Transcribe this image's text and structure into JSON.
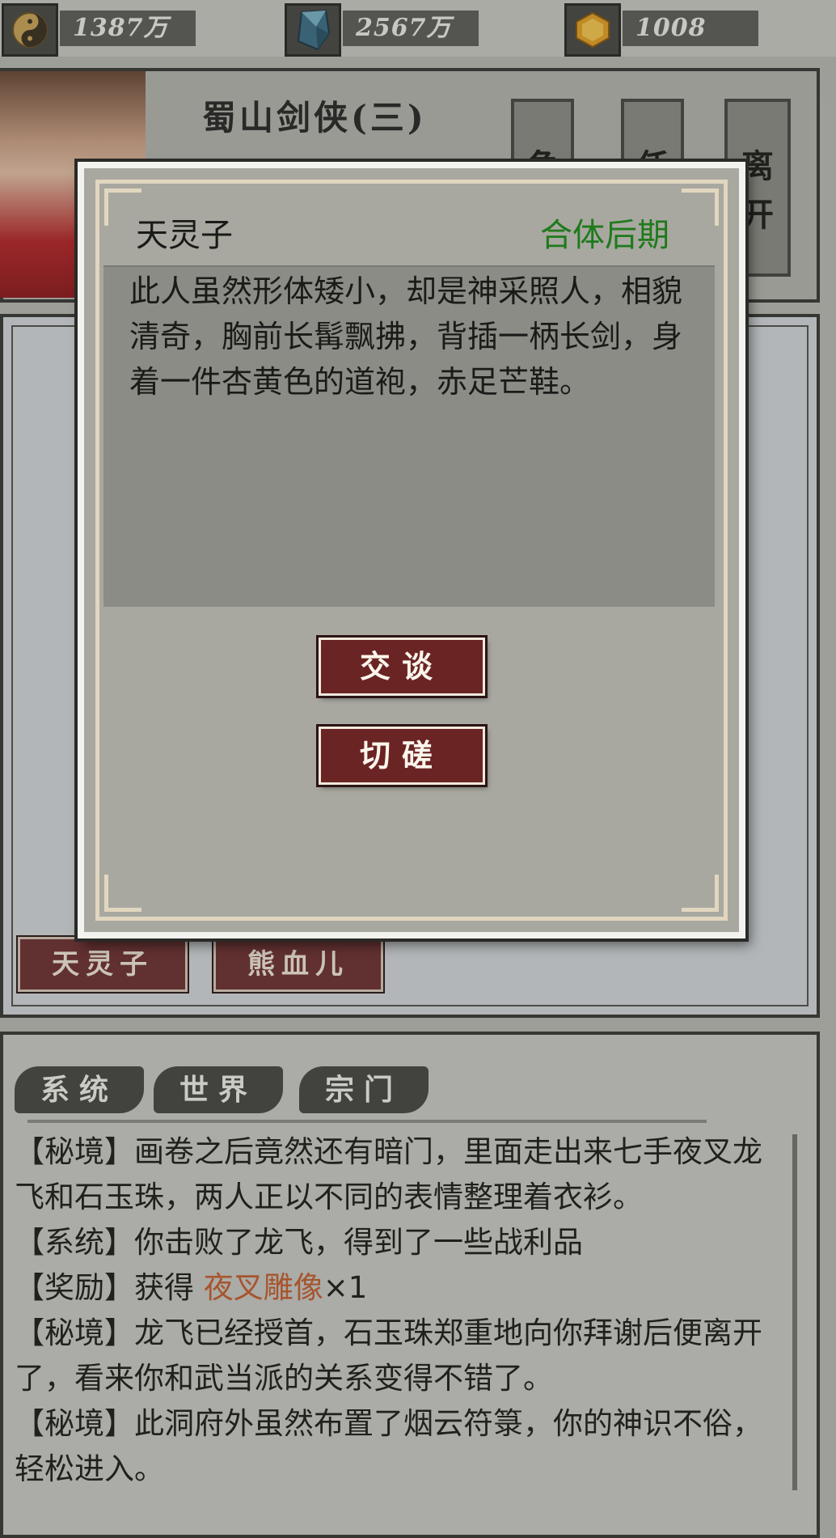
{
  "resources": [
    {
      "icon": "yin-yang-icon",
      "value": "1387万"
    },
    {
      "icon": "crystal-icon",
      "value": "2567万"
    },
    {
      "icon": "gold-gem-icon",
      "value": "1008"
    }
  ],
  "header": {
    "scene_title": "蜀山剑侠(三)",
    "side_buttons": [
      "角",
      "任",
      "离开"
    ]
  },
  "scene": {
    "npc_buttons": [
      "天灵子",
      "熊血儿"
    ]
  },
  "dialog": {
    "npc_name": "天灵子",
    "realm": "合体后期",
    "description": "此人虽然形体矮小，却是神采照人，相貌清奇，胸前长髯飘拂，背插一柄长剑，身着一件杏黄色的道袍，赤足芒鞋。",
    "actions": {
      "talk": "交谈",
      "spar": "切磋"
    }
  },
  "log": {
    "tabs": [
      "系统",
      "世界",
      "宗门"
    ],
    "lines": [
      {
        "text": "【秘境】画卷之后竟然还有暗门，里面走出来七手夜叉龙飞和石玉珠，两人正以不同的表情整理着衣衫。"
      },
      {
        "text": "【系统】你击败了龙飞，得到了一些战利品"
      },
      {
        "prefix": "【奖励】获得 ",
        "item": "夜叉雕像",
        "suffix": "×1"
      },
      {
        "text": "【秘境】龙飞已经授首，石玉珠郑重地向你拜谢后便离开了，看来你和武当派的关系变得不错了。"
      },
      {
        "text": "【秘境】此洞府外虽然布置了烟云符箓，你的神识不俗，轻松进入。"
      }
    ]
  },
  "colors": {
    "realm_green": "#1f7a1c",
    "item_orange": "#c2602f",
    "button_red": "#6a2424"
  }
}
